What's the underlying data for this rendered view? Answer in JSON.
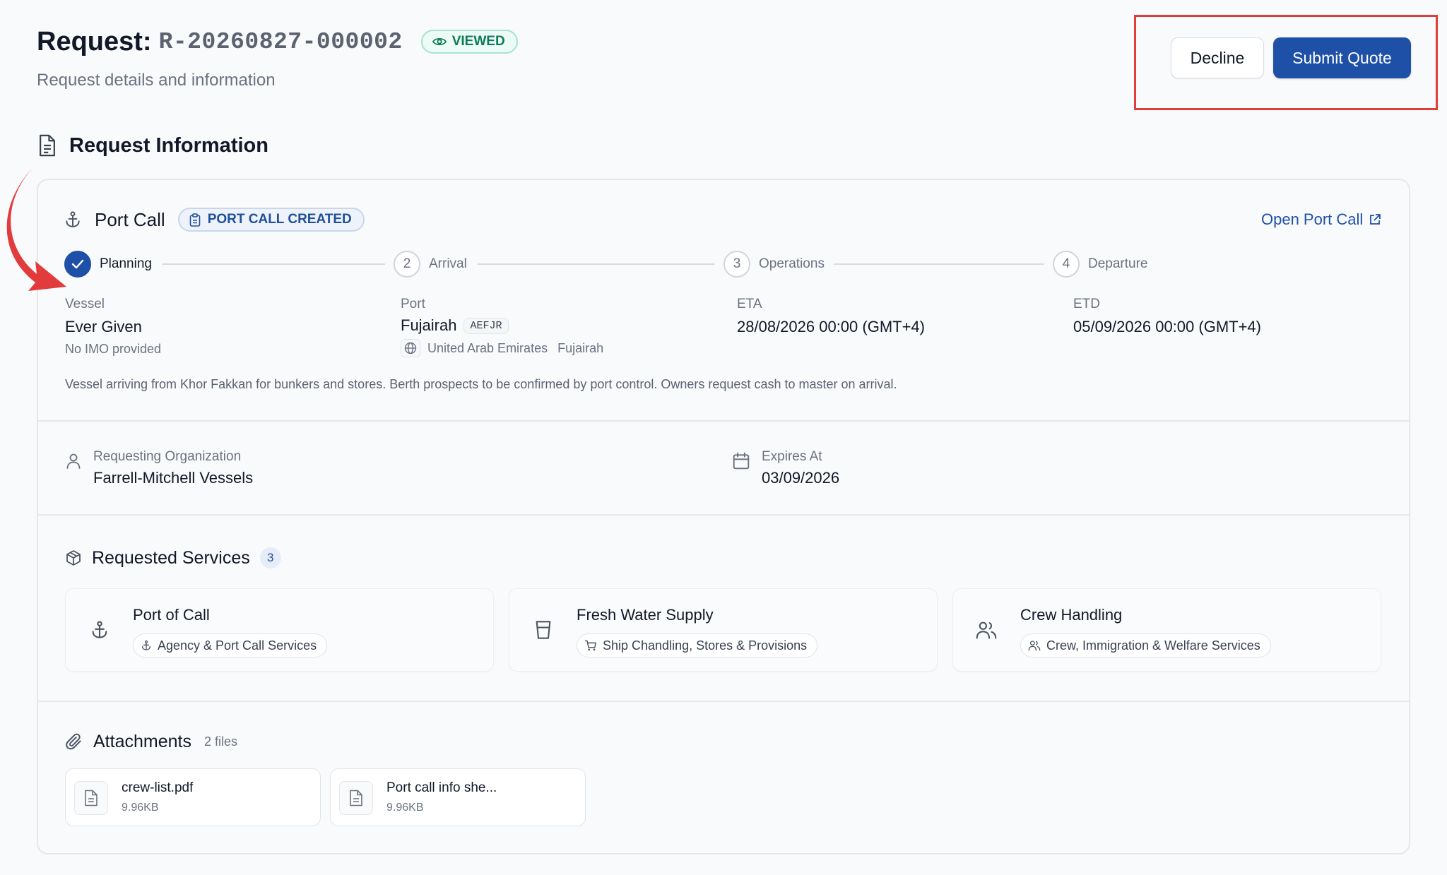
{
  "header": {
    "title_label": "Request:",
    "request_id": "R-20260827-000002",
    "status_badge": "VIEWED",
    "subtitle": "Request details and information",
    "decline_label": "Decline",
    "submit_label": "Submit Quote"
  },
  "section": {
    "title": "Request Information"
  },
  "port_call": {
    "title": "Port Call",
    "status_badge": "PORT CALL CREATED",
    "open_link": "Open Port Call",
    "steps": [
      {
        "label": "Planning",
        "marker": "✓",
        "state": "completed"
      },
      {
        "label": "Arrival",
        "marker": "2",
        "state": "pending"
      },
      {
        "label": "Operations",
        "marker": "3",
        "state": "pending"
      },
      {
        "label": "Departure",
        "marker": "4",
        "state": "pending"
      }
    ],
    "vessel": {
      "label": "Vessel",
      "name": "Ever Given",
      "imo": "No IMO provided"
    },
    "port": {
      "label": "Port",
      "name": "Fujairah",
      "code": "AEFJR",
      "country": "United Arab Emirates",
      "city": "Fujairah"
    },
    "eta": {
      "label": "ETA",
      "value": "28/08/2026 00:00 (GMT+4)"
    },
    "etd": {
      "label": "ETD",
      "value": "05/09/2026 00:00 (GMT+4)"
    },
    "note": "Vessel arriving from Khor Fakkan for bunkers and stores. Berth prospects to be confirmed by port control. Owners request cash to master on arrival."
  },
  "organization": {
    "label": "Requesting Organization",
    "value": "Farrell-Mitchell Vessels"
  },
  "expires": {
    "label": "Expires At",
    "value": "03/09/2026"
  },
  "services": {
    "title": "Requested Services",
    "count": "3",
    "items": [
      {
        "name": "Port of Call",
        "category": "Agency & Port Call Services",
        "icon": "anchor-icon"
      },
      {
        "name": "Fresh Water Supply",
        "category": "Ship Chandling, Stores & Provisions",
        "icon": "water-glass-icon"
      },
      {
        "name": "Crew Handling",
        "category": "Crew, Immigration & Welfare Services",
        "icon": "users-icon"
      }
    ]
  },
  "attachments": {
    "title": "Attachments",
    "count": "2 files",
    "files": [
      {
        "name": "crew-list.pdf",
        "size": "9.96KB"
      },
      {
        "name": "Port call info she...",
        "size": "9.96KB"
      }
    ]
  },
  "colors": {
    "accent": "#1f50a8",
    "success": "#0f7a5a",
    "annotation": "#e23b3b",
    "background": "#f9fafc"
  }
}
